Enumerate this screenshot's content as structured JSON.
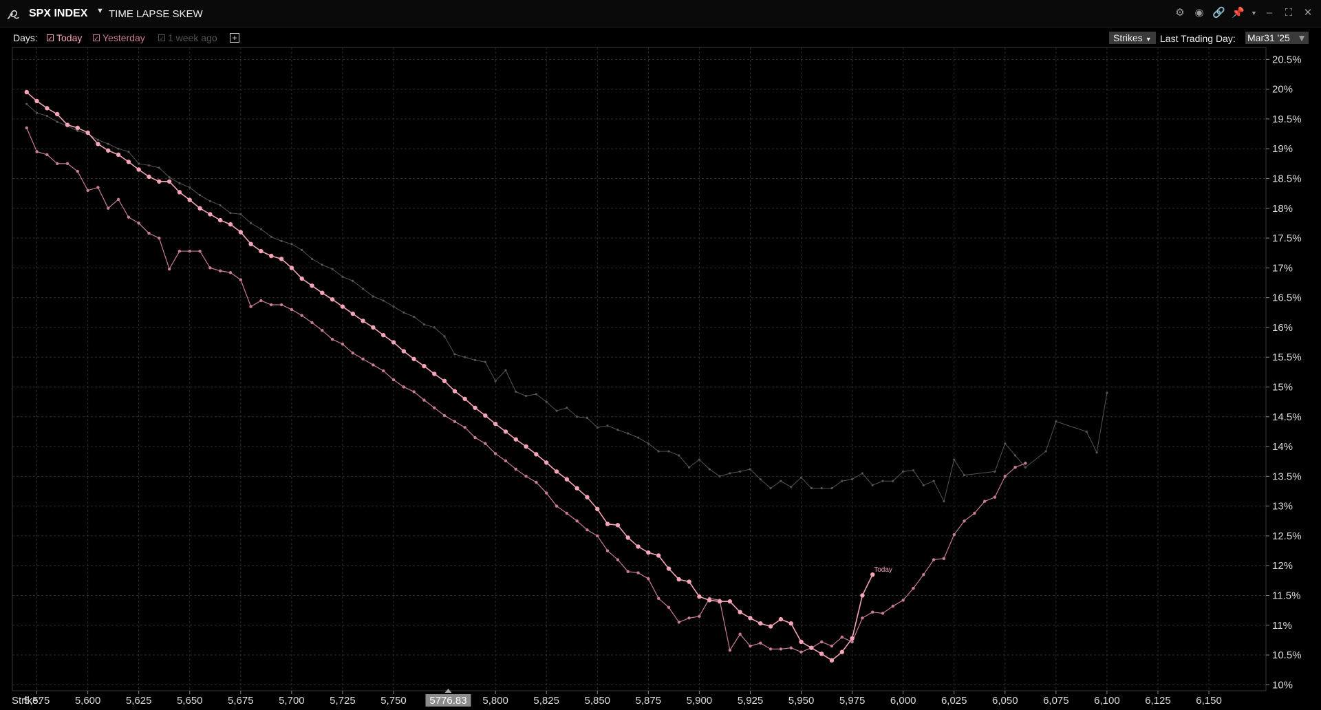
{
  "header": {
    "app_title": "SPX INDEX",
    "app_title_dropdown_icon": "caret-down-icon",
    "subtitle": "TIME LAPSE SKEW",
    "icons": [
      "gear-icon",
      "camera-icon",
      "link-icon",
      "pin-icon",
      "minimize-icon",
      "maximize-icon",
      "close-icon"
    ]
  },
  "toolbar": {
    "days_label": "Days:",
    "day_options": [
      {
        "label": "Today",
        "checked": true,
        "color": "#f4a6b8"
      },
      {
        "label": "Yesterday",
        "checked": true,
        "color": "#c87e92"
      },
      {
        "label": "1 week ago",
        "checked": true,
        "color": "#555555"
      }
    ],
    "add_label": "+",
    "strikes_label": "Strikes",
    "last_trading_day_label": "Last Trading Day:",
    "last_trading_day_value": "Mar31 '25"
  },
  "chart_data": {
    "type": "line",
    "xlabel": "Strike:",
    "x_ticks": [
      5575,
      5600,
      5625,
      5650,
      5675,
      5700,
      5725,
      5750,
      5800,
      5825,
      5850,
      5875,
      5900,
      5925,
      5950,
      5975,
      6000,
      6025,
      6050,
      6075,
      6100,
      6125,
      6150
    ],
    "x_tick_labels": [
      "5,575",
      "5,600",
      "5,625",
      "5,650",
      "5,675",
      "5,700",
      "5,725",
      "5,750",
      "5,800",
      "5,825",
      "5,850",
      "5,875",
      "5,900",
      "5,925",
      "5,950",
      "5,975",
      "6,000",
      "6,025",
      "6,050",
      "6,075",
      "6,100",
      "6,125",
      "6,150"
    ],
    "xlim": [
      5563,
      6178
    ],
    "spot_marker": {
      "value": 5776.83,
      "label": "5776.83"
    },
    "y_ticks": [
      10,
      10.5,
      11,
      11.5,
      12,
      12.5,
      13,
      13.5,
      14,
      14.5,
      15,
      15.5,
      16,
      16.5,
      17,
      17.5,
      18,
      18.5,
      19,
      19.5,
      20,
      20.5
    ],
    "y_tick_labels": [
      "10%",
      "10.5%",
      "11%",
      "11.5%",
      "12%",
      "12.5%",
      "13%",
      "13.5%",
      "14%",
      "14.5%",
      "15%",
      "15.5%",
      "16%",
      "16.5%",
      "17%",
      "17.5%",
      "18%",
      "18.5%",
      "19%",
      "19.5%",
      "20%",
      "20.5%"
    ],
    "ylim": [
      9.9,
      20.7
    ],
    "grid": true,
    "annotations": [
      {
        "text": "Today",
        "x": 5985,
        "y": 11.85
      }
    ],
    "series": [
      {
        "name": "Today",
        "color": "#f4a6b8",
        "x": [
          5570,
          5575,
          5580,
          5585,
          5590,
          5595,
          5600,
          5605,
          5610,
          5615,
          5620,
          5625,
          5630,
          5635,
          5640,
          5645,
          5650,
          5655,
          5660,
          5665,
          5670,
          5675,
          5680,
          5685,
          5690,
          5695,
          5700,
          5705,
          5710,
          5715,
          5720,
          5725,
          5730,
          5735,
          5740,
          5745,
          5750,
          5755,
          5760,
          5765,
          5770,
          5775,
          5780,
          5785,
          5790,
          5795,
          5800,
          5805,
          5810,
          5815,
          5820,
          5825,
          5830,
          5835,
          5840,
          5845,
          5850,
          5855,
          5860,
          5865,
          5870,
          5875,
          5880,
          5885,
          5890,
          5895,
          5900,
          5905,
          5910,
          5915,
          5920,
          5925,
          5930,
          5935,
          5940,
          5945,
          5950,
          5955,
          5960,
          5965,
          5970,
          5975,
          5980,
          5985
        ],
        "y": [
          19.95,
          19.8,
          19.68,
          19.58,
          19.4,
          19.35,
          19.27,
          19.08,
          18.97,
          18.9,
          18.78,
          18.65,
          18.53,
          18.45,
          18.45,
          18.27,
          18.14,
          18.0,
          17.9,
          17.8,
          17.73,
          17.6,
          17.4,
          17.28,
          17.2,
          17.15,
          17.0,
          16.82,
          16.7,
          16.58,
          16.47,
          16.35,
          16.23,
          16.11,
          16.0,
          15.87,
          15.75,
          15.6,
          15.47,
          15.35,
          15.22,
          15.1,
          14.93,
          14.8,
          14.65,
          14.52,
          14.38,
          14.25,
          14.12,
          14.0,
          13.87,
          13.73,
          13.58,
          13.45,
          13.3,
          13.15,
          12.95,
          12.7,
          12.68,
          12.47,
          12.32,
          12.22,
          12.17,
          11.95,
          11.77,
          11.73,
          11.48,
          11.42,
          11.4,
          11.4,
          11.22,
          11.12,
          11.03,
          10.98,
          11.1,
          11.03,
          10.72,
          10.62,
          10.52,
          10.41,
          10.55,
          10.78,
          11.5,
          11.85
        ]
      },
      {
        "name": "Yesterday",
        "color": "#c87e92",
        "x": [
          5570,
          5575,
          5580,
          5585,
          5590,
          5595,
          5600,
          5605,
          5610,
          5615,
          5620,
          5625,
          5630,
          5635,
          5640,
          5645,
          5650,
          5655,
          5660,
          5665,
          5670,
          5675,
          5680,
          5685,
          5690,
          5695,
          5700,
          5705,
          5710,
          5715,
          5720,
          5725,
          5730,
          5735,
          5740,
          5745,
          5750,
          5755,
          5760,
          5765,
          5770,
          5775,
          5780,
          5785,
          5790,
          5795,
          5800,
          5805,
          5810,
          5815,
          5820,
          5825,
          5830,
          5835,
          5840,
          5845,
          5850,
          5855,
          5860,
          5865,
          5870,
          5875,
          5880,
          5885,
          5890,
          5895,
          5900,
          5905,
          5910,
          5915,
          5920,
          5925,
          5930,
          5935,
          5940,
          5945,
          5950,
          5955,
          5960,
          5965,
          5970,
          5975,
          5980,
          5985,
          5990,
          5995,
          6000,
          6005,
          6010,
          6015,
          6020,
          6025,
          6030,
          6035,
          6040,
          6045,
          6050,
          6055,
          6060
        ],
        "y": [
          19.35,
          18.95,
          18.9,
          18.75,
          18.75,
          18.62,
          18.3,
          18.35,
          18.0,
          18.15,
          17.85,
          17.75,
          17.58,
          17.5,
          16.98,
          17.28,
          17.28,
          17.28,
          17.0,
          16.95,
          16.92,
          16.8,
          16.35,
          16.45,
          16.38,
          16.38,
          16.3,
          16.2,
          16.08,
          15.95,
          15.8,
          15.72,
          15.57,
          15.47,
          15.37,
          15.27,
          15.12,
          15.0,
          14.92,
          14.78,
          14.65,
          14.52,
          14.42,
          14.32,
          14.15,
          14.05,
          13.88,
          13.76,
          13.62,
          13.5,
          13.4,
          13.22,
          13.0,
          12.88,
          12.75,
          12.6,
          12.5,
          12.25,
          12.1,
          11.9,
          11.88,
          11.78,
          11.45,
          11.3,
          11.05,
          11.12,
          11.15,
          11.45,
          11.42,
          10.58,
          10.85,
          10.65,
          10.7,
          10.6,
          10.6,
          10.62,
          10.55,
          10.62,
          10.72,
          10.65,
          10.8,
          10.72,
          11.12,
          11.22,
          11.2,
          11.32,
          11.42,
          11.62,
          11.85,
          12.1,
          12.12,
          12.52,
          12.75,
          12.88,
          13.08,
          13.15,
          13.5,
          13.65,
          13.72
        ]
      },
      {
        "name": "1 week ago",
        "color": "#555555",
        "x": [
          5570,
          5575,
          5580,
          5585,
          5590,
          5595,
          5600,
          5605,
          5610,
          5615,
          5620,
          5625,
          5630,
          5635,
          5640,
          5645,
          5650,
          5655,
          5660,
          5665,
          5670,
          5675,
          5680,
          5685,
          5690,
          5695,
          5700,
          5705,
          5710,
          5715,
          5720,
          5725,
          5730,
          5735,
          5740,
          5745,
          5750,
          5755,
          5760,
          5765,
          5770,
          5775,
          5780,
          5785,
          5790,
          5795,
          5800,
          5805,
          5810,
          5815,
          5820,
          5825,
          5830,
          5835,
          5840,
          5845,
          5850,
          5855,
          5860,
          5865,
          5870,
          5875,
          5880,
          5885,
          5890,
          5895,
          5900,
          5905,
          5910,
          5915,
          5920,
          5925,
          5930,
          5935,
          5940,
          5945,
          5950,
          5955,
          5960,
          5965,
          5970,
          5975,
          5980,
          5985,
          5990,
          5995,
          6000,
          6005,
          6010,
          6015,
          6020,
          6025,
          6030,
          6045,
          6050,
          6055,
          6060,
          6070,
          6075,
          6090,
          6095,
          6100
        ],
        "y": [
          19.75,
          19.6,
          19.55,
          19.45,
          19.38,
          19.3,
          19.25,
          19.15,
          19.08,
          19.0,
          18.95,
          18.75,
          18.72,
          18.68,
          18.52,
          18.42,
          18.35,
          18.22,
          18.12,
          18.05,
          17.92,
          17.9,
          17.75,
          17.65,
          17.52,
          17.45,
          17.4,
          17.3,
          17.15,
          17.05,
          16.98,
          16.85,
          16.78,
          16.65,
          16.52,
          16.45,
          16.35,
          16.25,
          16.18,
          16.05,
          16.0,
          15.85,
          15.55,
          15.5,
          15.45,
          15.42,
          15.1,
          15.28,
          14.92,
          14.85,
          14.88,
          14.75,
          14.6,
          14.65,
          14.5,
          14.48,
          14.32,
          14.35,
          14.28,
          14.22,
          14.15,
          14.05,
          13.92,
          13.92,
          13.85,
          13.65,
          13.78,
          13.62,
          13.5,
          13.55,
          13.58,
          13.62,
          13.45,
          13.3,
          13.42,
          13.32,
          13.48,
          13.3,
          13.3,
          13.3,
          13.42,
          13.45,
          13.55,
          13.35,
          13.42,
          13.42,
          13.58,
          13.6,
          13.35,
          13.42,
          13.08,
          13.78,
          13.52,
          13.58,
          14.05,
          13.85,
          13.65,
          13.92,
          14.42,
          14.25,
          13.9,
          14.9
        ]
      }
    ]
  }
}
